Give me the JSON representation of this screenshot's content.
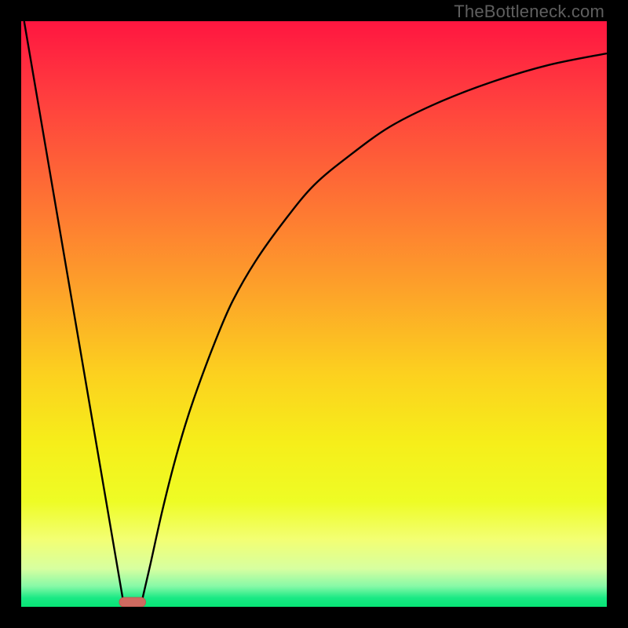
{
  "watermark": "TheBottleneck.com",
  "colors": {
    "black": "#000000",
    "curve": "#000000",
    "marker_fill": "#cf6a60",
    "marker_stroke": "#bd5b52"
  },
  "chart_data": {
    "type": "line",
    "title": "",
    "xlabel": "",
    "ylabel": "",
    "xlim": [
      0,
      100
    ],
    "ylim": [
      0,
      100
    ],
    "grid": false,
    "legend": false,
    "background_gradient_stops": [
      {
        "offset": 0.0,
        "color": "#ff1640"
      },
      {
        "offset": 0.12,
        "color": "#ff3b3f"
      },
      {
        "offset": 0.3,
        "color": "#fe7134"
      },
      {
        "offset": 0.45,
        "color": "#fd9f2a"
      },
      {
        "offset": 0.6,
        "color": "#fcd01f"
      },
      {
        "offset": 0.72,
        "color": "#f6ee1a"
      },
      {
        "offset": 0.82,
        "color": "#eefc25"
      },
      {
        "offset": 0.885,
        "color": "#f3ff73"
      },
      {
        "offset": 0.935,
        "color": "#d7ffa0"
      },
      {
        "offset": 0.965,
        "color": "#86f9a7"
      },
      {
        "offset": 0.985,
        "color": "#19e984"
      },
      {
        "offset": 1.0,
        "color": "#07e575"
      }
    ],
    "series": [
      {
        "name": "left-leg",
        "x": [
          0.5,
          17.5
        ],
        "y": [
          100,
          0.5
        ]
      },
      {
        "name": "right-curve",
        "x": [
          20.5,
          22,
          24,
          26,
          28,
          30,
          33,
          36,
          40,
          45,
          50,
          56,
          63,
          71,
          80,
          90,
          100
        ],
        "y": [
          0.5,
          7,
          16,
          24,
          31,
          37,
          45,
          52,
          59,
          66,
          72,
          77,
          82,
          86,
          89.5,
          92.5,
          94.5
        ]
      }
    ],
    "marker": {
      "x_center": 19.0,
      "width": 4.5,
      "height": 1.6,
      "rx": 0.8
    }
  }
}
